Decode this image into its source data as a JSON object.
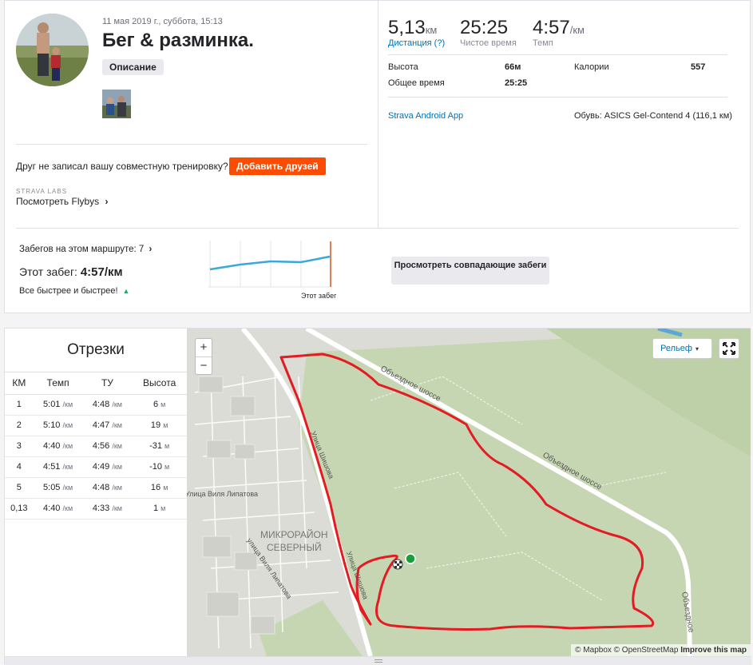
{
  "activity": {
    "date": "11 мая 2019 г., суббота, 15:13",
    "title": "Бег & разминка.",
    "description_button": "Описание"
  },
  "friends": {
    "prompt": "Друг не записал вашу совместную тренировку?",
    "add_button": "Добавить друзей"
  },
  "labs": {
    "label": "STRAVA LABS",
    "flybys": "Посмотреть Flybys",
    "chevron": "›"
  },
  "stats": {
    "distance": {
      "value": "5,13",
      "unit": "км",
      "label": "Дистанция (?)"
    },
    "moving_time": {
      "value": "25:25",
      "label": "Чистое время"
    },
    "pace": {
      "value": "4:57",
      "unit": "/км",
      "label": "Темп"
    },
    "elevation_label": "Высота",
    "elevation_value": "66м",
    "calories_label": "Калории",
    "calories_value": "557",
    "elapsed_label": "Общее время",
    "elapsed_value": "25:25",
    "device": "Strava Android App",
    "shoes": "Обувь: ASICS Gel-Contend 4 (116,1 км)"
  },
  "route": {
    "runs_label": "Забегов на этом маршруте: 7",
    "chevron": "›",
    "this_run_prefix": "Этот забег: ",
    "this_run_pace": "4:57/км",
    "faster_text": "Все быстрее и быстрее!",
    "faster_icon": "▲",
    "chart_marker_label": "Этот забег",
    "match_button": "Просмотреть совпадающие забеги",
    "colors": {
      "line": "#3aa8d8",
      "marker": "#d9531e"
    }
  },
  "splits": {
    "title": "Отрезки",
    "headers": [
      "КМ",
      "Темп",
      "ТУ",
      "Высота"
    ],
    "pace_unit": "/км",
    "elev_unit": "м",
    "rows": [
      {
        "km": "1",
        "pace": "5:01",
        "gap": "4:48",
        "elev": "6"
      },
      {
        "km": "2",
        "pace": "5:10",
        "gap": "4:47",
        "elev": "19"
      },
      {
        "km": "3",
        "pace": "4:40",
        "gap": "4:56",
        "elev": "-31"
      },
      {
        "km": "4",
        "pace": "4:51",
        "gap": "4:49",
        "elev": "-10"
      },
      {
        "km": "5",
        "pace": "5:05",
        "gap": "4:48",
        "elev": "16"
      },
      {
        "km": "0,13",
        "pace": "4:40",
        "gap": "4:33",
        "elev": "1"
      }
    ]
  },
  "map": {
    "zoom_in": "+",
    "zoom_out": "−",
    "layer_button": "Рельеф",
    "caret": "▾",
    "labels": {
      "district_1": "МИКРОРАЙОН",
      "district_2": "СЕВЕРНЫЙ",
      "road_1": "Объездное шоссе",
      "road_2": "Объездное шоссе",
      "road_3": "Объездное",
      "street_1": "Улица Шишова",
      "street_2": "Улица Виля Липатова",
      "street_3": "улица Виля Липатова",
      "street_4": "Улица Шишова"
    },
    "attribution_1": "© Mapbox © OpenStreetMap",
    "attribution_2": "Improve this map",
    "colors": {
      "route": "#e31b23",
      "start": "#1a9e3a",
      "bg": "#d9dccc",
      "forest": "#c5d4b0",
      "road": "#ffffff"
    }
  }
}
